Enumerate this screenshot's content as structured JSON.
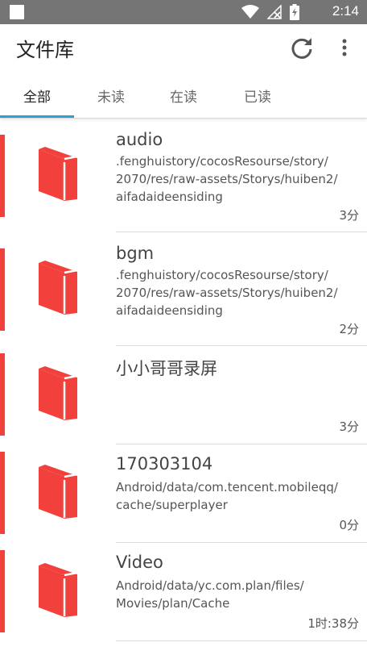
{
  "status_bar": {
    "time": "2:14",
    "icons": [
      "notification-square-icon",
      "wifi-icon",
      "signal-off-icon",
      "battery-charging-icon"
    ]
  },
  "app_bar": {
    "title": "文件库",
    "actions": [
      "refresh-icon",
      "more-vert-icon"
    ]
  },
  "tabs": [
    {
      "label": "全部",
      "active": true
    },
    {
      "label": "未读",
      "active": false
    },
    {
      "label": "在读",
      "active": false
    },
    {
      "label": "已读",
      "active": false
    }
  ],
  "items": [
    {
      "title": "audio",
      "path": ".fenghuistory/cocosResourse/story/\n2070/res/raw-assets/Storys/huiben2/\naifadaideensiding",
      "duration": "3分"
    },
    {
      "title": "bgm",
      "path": ".fenghuistory/cocosResourse/story/\n2070/res/raw-assets/Storys/huiben2/\naifadaideensiding",
      "duration": "2分"
    },
    {
      "title": "小小哥哥录屏",
      "path": "",
      "duration": "3分"
    },
    {
      "title": "170303104",
      "path": "Android/data/com.tencent.mobileqq/\ncache/superplayer",
      "duration": "0分"
    },
    {
      "title": "Video",
      "path": "Android/data/yc.com.plan/files/\nMovies/plan/Cache",
      "duration": "1时:38分"
    }
  ],
  "colors": {
    "accent": "#f2413d",
    "tab_indicator": "#2b9fd6",
    "status_bar": "#757575"
  }
}
